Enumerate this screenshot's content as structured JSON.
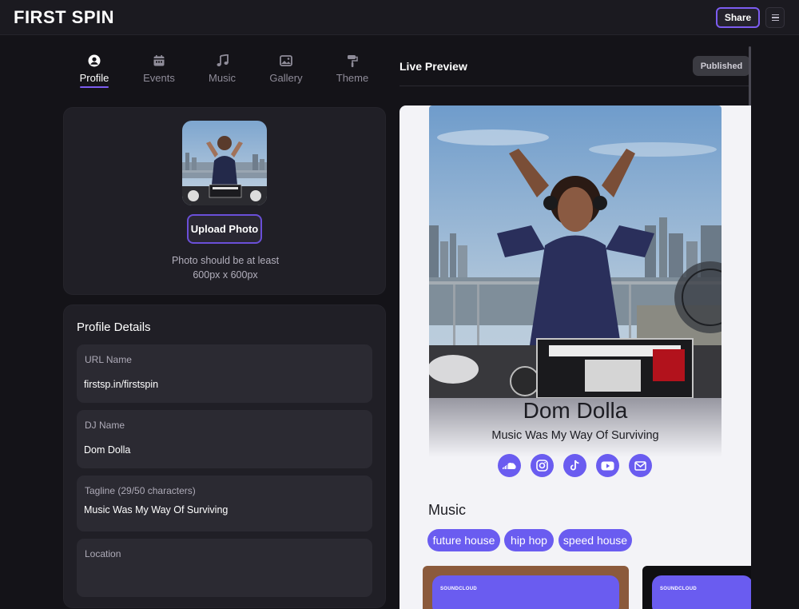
{
  "app": {
    "brand": "FIRST SPIN",
    "share_label": "Share"
  },
  "tabs": [
    {
      "label": "Profile",
      "icon": "user-circle-icon",
      "active": true
    },
    {
      "label": "Events",
      "icon": "calendar-icon",
      "active": false
    },
    {
      "label": "Music",
      "icon": "music-notes-icon",
      "active": false
    },
    {
      "label": "Gallery",
      "icon": "image-icon",
      "active": false
    },
    {
      "label": "Theme",
      "icon": "paint-roller-icon",
      "active": false
    }
  ],
  "photo": {
    "upload_label": "Upload Photo",
    "hint_line1": "Photo should be at least",
    "hint_line2": "600px x 600px"
  },
  "details": {
    "title": "Profile Details",
    "fields": [
      {
        "label": "URL Name",
        "value": "firstsp.in/firstspin"
      },
      {
        "label": "DJ Name",
        "value": "Dom Dolla"
      },
      {
        "label": "Tagline (29/50 characters)",
        "value": "Music Was My Way Of Surviving"
      },
      {
        "label": "Location",
        "value": ""
      }
    ]
  },
  "preview": {
    "title": "Live Preview",
    "status": "Published",
    "dj_name": "Dom Dolla",
    "tagline": "Music Was My Way Of Surviving",
    "socials": [
      "soundcloud-icon",
      "instagram-icon",
      "tiktok-icon",
      "youtube-icon",
      "email-icon"
    ],
    "music_heading": "Music",
    "genres": [
      "future house",
      "hip hop",
      "speed house"
    ],
    "embed_label": "SOUNDCLOUD"
  },
  "colors": {
    "accent": "#7c5cf0",
    "chip": "#6a5cf0",
    "background": "#141318",
    "card": "#201f26"
  }
}
